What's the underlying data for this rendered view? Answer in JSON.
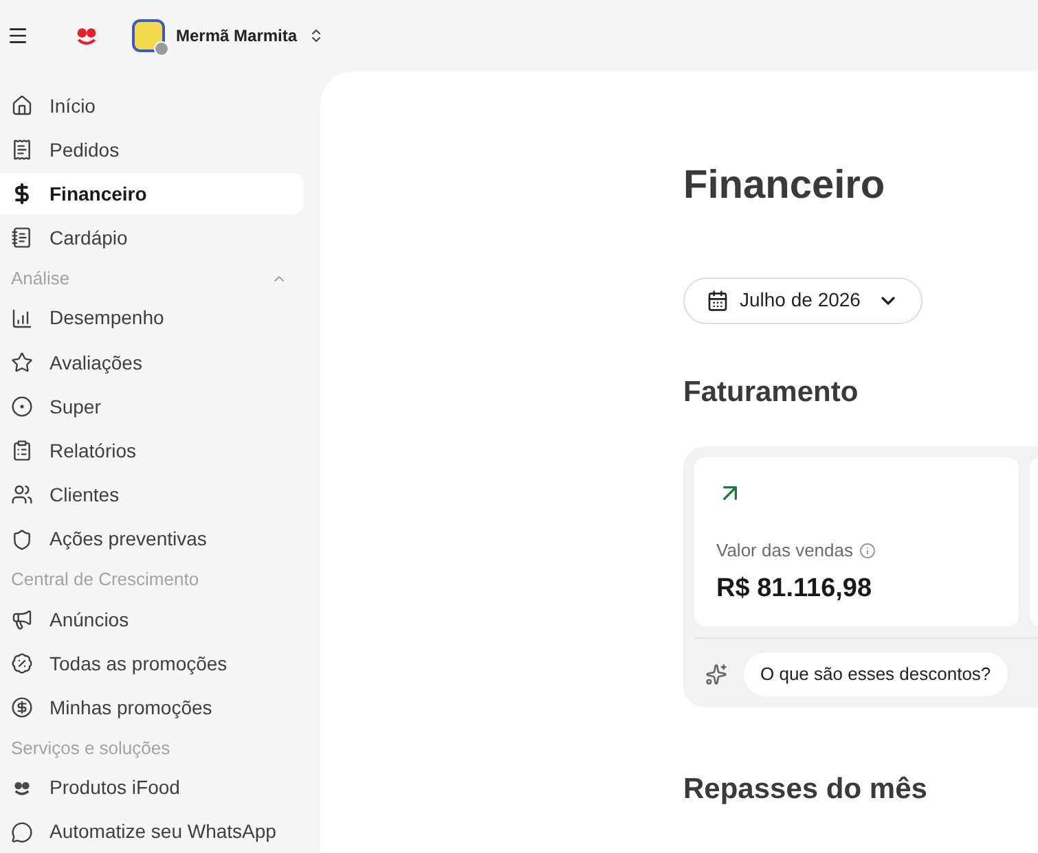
{
  "header": {
    "store_name": "Mermã Marmita"
  },
  "sidebar": {
    "items": [
      {
        "kind": "item",
        "label": "Início",
        "selected": false
      },
      {
        "kind": "item",
        "label": "Pedidos",
        "selected": false
      },
      {
        "kind": "item",
        "label": "Financeiro",
        "selected": true
      },
      {
        "kind": "item",
        "label": "Cardápio",
        "selected": false
      },
      {
        "kind": "section",
        "label": "Análise",
        "expanded": true
      },
      {
        "kind": "item",
        "label": "Desempenho",
        "selected": false
      },
      {
        "kind": "item",
        "label": "Avaliações",
        "selected": false
      },
      {
        "kind": "item",
        "label": "Super",
        "selected": false
      },
      {
        "kind": "item",
        "label": "Relatórios",
        "selected": false
      },
      {
        "kind": "item",
        "label": "Clientes",
        "selected": false
      },
      {
        "kind": "item",
        "label": "Ações preventivas",
        "selected": false
      },
      {
        "kind": "section",
        "label": "Central de Crescimento"
      },
      {
        "kind": "item",
        "label": "Anúncios",
        "selected": false
      },
      {
        "kind": "item",
        "label": "Todas as promoções",
        "selected": false
      },
      {
        "kind": "item",
        "label": "Minhas promoções",
        "selected": false
      },
      {
        "kind": "section",
        "label": "Serviços e soluções"
      },
      {
        "kind": "item",
        "label": "Produtos iFood",
        "selected": false
      },
      {
        "kind": "item",
        "label": "Automatize seu WhatsApp",
        "selected": false
      }
    ]
  },
  "main": {
    "title": "Financeiro",
    "period": "Julho de 2026",
    "billing": {
      "title": "Faturamento",
      "cards": [
        {
          "label": "Valor das vendas",
          "value": "R$ 81.116,98"
        }
      ],
      "questions": [
        "O que são esses descontos?"
      ]
    },
    "transfers": {
      "title": "Repasses do mês"
    }
  }
}
